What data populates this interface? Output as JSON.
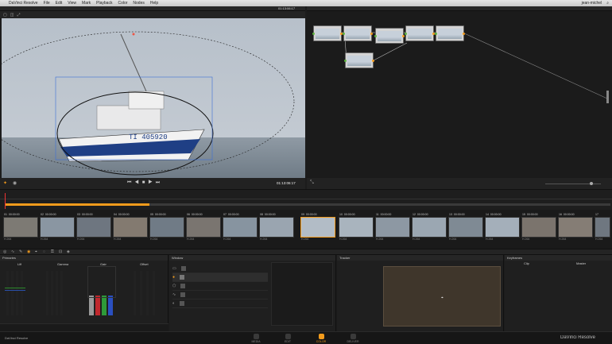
{
  "menubar": {
    "app": "DaVinci Resolve",
    "items": [
      "File",
      "Edit",
      "View",
      "Mark",
      "Playback",
      "Color",
      "Nodes",
      "Help"
    ],
    "right_user": "jean-michel"
  },
  "viewer": {
    "title": "",
    "timecode": "01:13:06:17",
    "boat_text": "TI 405920"
  },
  "timeline": {
    "clips": [
      {
        "num": "01",
        "tc": "00:00:00",
        "codec": "H.264"
      },
      {
        "num": "02",
        "tc": "00:00:00",
        "codec": "H.264"
      },
      {
        "num": "03",
        "tc": "00:00:00",
        "codec": "H.264"
      },
      {
        "num": "04",
        "tc": "00:00:00",
        "codec": "H.264"
      },
      {
        "num": "05",
        "tc": "00:00:00",
        "codec": "H.264"
      },
      {
        "num": "06",
        "tc": "00:00:00",
        "codec": "H.264"
      },
      {
        "num": "07",
        "tc": "00:00:00",
        "codec": "H.264"
      },
      {
        "num": "08",
        "tc": "00:00:00",
        "codec": "H.264"
      },
      {
        "num": "09",
        "tc": "00:00:00",
        "codec": "H.264"
      },
      {
        "num": "10",
        "tc": "00:00:00",
        "codec": "H.264"
      },
      {
        "num": "11",
        "tc": "00:00:00",
        "codec": "H.264"
      },
      {
        "num": "12",
        "tc": "00:00:00",
        "codec": "H.264"
      },
      {
        "num": "13",
        "tc": "00:00:00",
        "codec": "H.264"
      },
      {
        "num": "14",
        "tc": "00:00:00",
        "codec": "H.264"
      },
      {
        "num": "15",
        "tc": "00:00:00",
        "codec": "H.264"
      },
      {
        "num": "16",
        "tc": "00:00:00",
        "codec": "H.264"
      },
      {
        "num": "17",
        "tc": "00:00:00",
        "codec": "H.264"
      }
    ]
  },
  "panels": {
    "primaries": "Primaries",
    "lift": "Lift",
    "gamma": "Gamma",
    "gain": "Gain",
    "offset": "Offset",
    "window": "Window",
    "tracker": "Tracker",
    "blur": "Blur",
    "keyframes": "Keyframes",
    "clip_label": "Clip",
    "master_label": "Master"
  },
  "nav": {
    "media": "MEDIA",
    "edit": "EDIT",
    "color": "COLOR",
    "deliver": "DELIVER",
    "brand": "DaVinci Resolve"
  },
  "footer_left": "DaVinci Resolve"
}
